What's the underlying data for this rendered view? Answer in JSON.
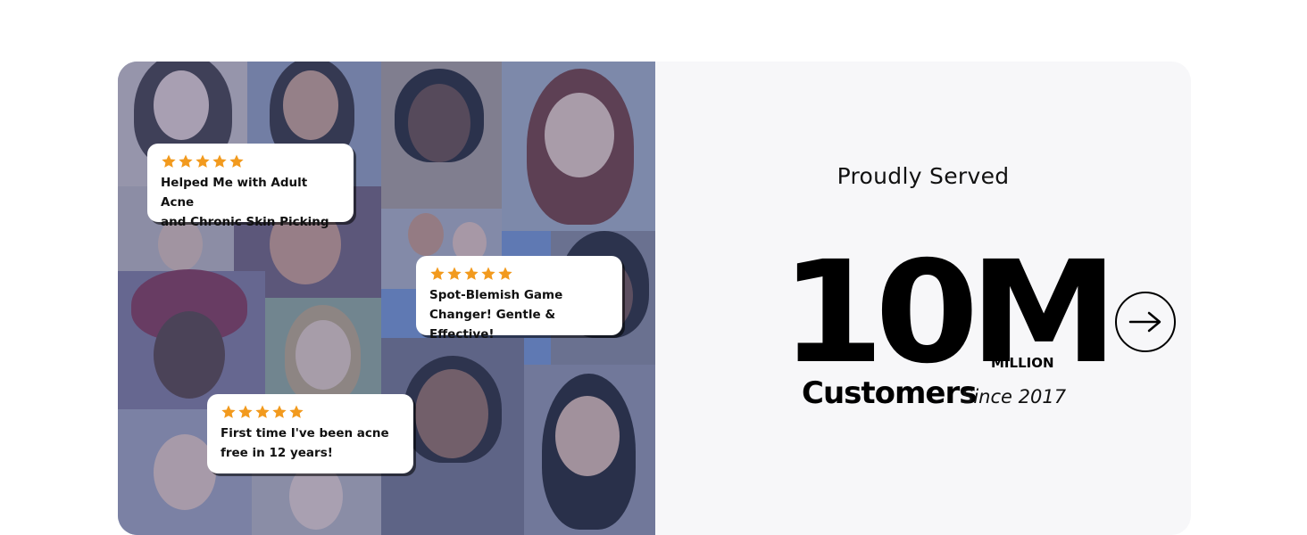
{
  "reviews": [
    {
      "text": "Helped Me with Adult Acne\nand Chronic Skin Picking",
      "rating": 5
    },
    {
      "text": "Spot-Blemish Game\nChanger! Gentle & Effective!",
      "rating": 5
    },
    {
      "text": "First time I've been acne\nfree in 12 years!",
      "rating": 5
    }
  ],
  "stats": {
    "eyebrow": "Proudly Served",
    "number": "10M",
    "unit": "MILLION",
    "label": "Customers",
    "since": "Since 2017"
  },
  "icons": {
    "next": "arrow-right-icon",
    "star": "star-icon"
  },
  "colors": {
    "star": "#f29a1e",
    "card_bg": "#f7f7f9",
    "tint": "#6f86b8"
  }
}
